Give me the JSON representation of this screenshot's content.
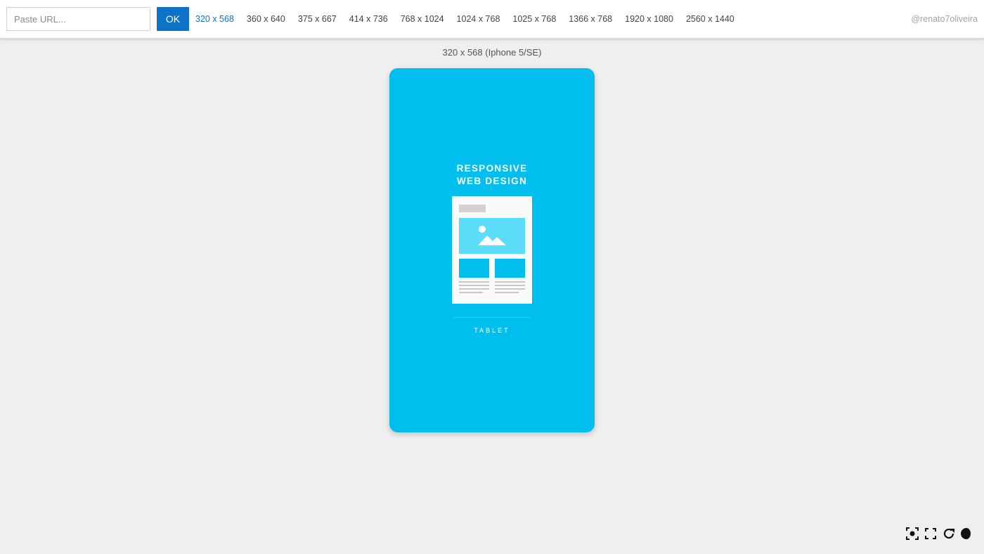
{
  "toolbar": {
    "url_placeholder": "Paste URL...",
    "ok_label": "OK",
    "sizes": [
      {
        "label": "320 x 568",
        "active": true
      },
      {
        "label": "360 x 640",
        "active": false
      },
      {
        "label": "375 x 667",
        "active": false
      },
      {
        "label": "414 x 736",
        "active": false
      },
      {
        "label": "768 x 1024",
        "active": false
      },
      {
        "label": "1024 x 768",
        "active": false
      },
      {
        "label": "1025 x 768",
        "active": false
      },
      {
        "label": "1366 x 768",
        "active": false
      },
      {
        "label": "1920 x 1080",
        "active": false
      },
      {
        "label": "2560 x 1440",
        "active": false
      }
    ],
    "credit": "@renato7oliveira"
  },
  "preview": {
    "device_label": "320 x 568 (Iphone 5/SE)",
    "title_line1": "RESPONSIVE",
    "title_line2": "WEB DESIGN",
    "caption": "TABLET"
  },
  "colors": {
    "accent": "#0e72c9",
    "device_bg": "#00bfee",
    "page_bg": "#efefef"
  },
  "tools": [
    {
      "icon": "screenshot-icon"
    },
    {
      "icon": "fullscreen-icon"
    },
    {
      "icon": "refresh-icon"
    },
    {
      "icon": "dark-mode-icon"
    }
  ]
}
